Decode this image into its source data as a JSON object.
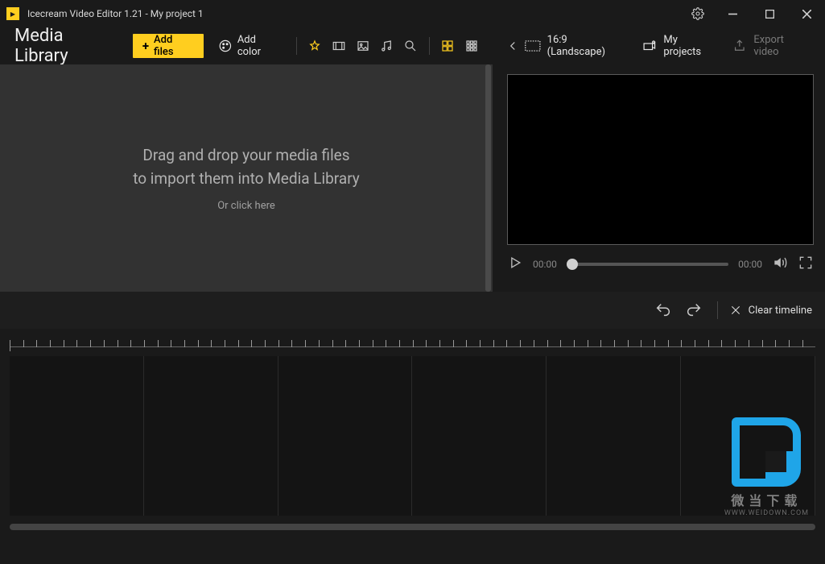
{
  "titlebar": {
    "app_title": "Icecream Video Editor 1.21 - My project 1"
  },
  "toolbar": {
    "media_library_label": "Media Library",
    "add_files_label": "Add files",
    "add_color_label": "Add color"
  },
  "right_toolbar": {
    "aspect_label": "16:9 (Landscape)",
    "my_projects_label": "My projects",
    "export_label": "Export video"
  },
  "media_drop": {
    "line1": "Drag and drop your media files",
    "line2": "to import them into Media Library",
    "sub": "Or click here"
  },
  "preview": {
    "time_current": "00:00",
    "time_total": "00:00"
  },
  "timeline_actions": {
    "clear_label": "Clear timeline"
  },
  "watermark": {
    "cn": "微当下载",
    "url": "WWW.WEIDOWN.COM"
  }
}
